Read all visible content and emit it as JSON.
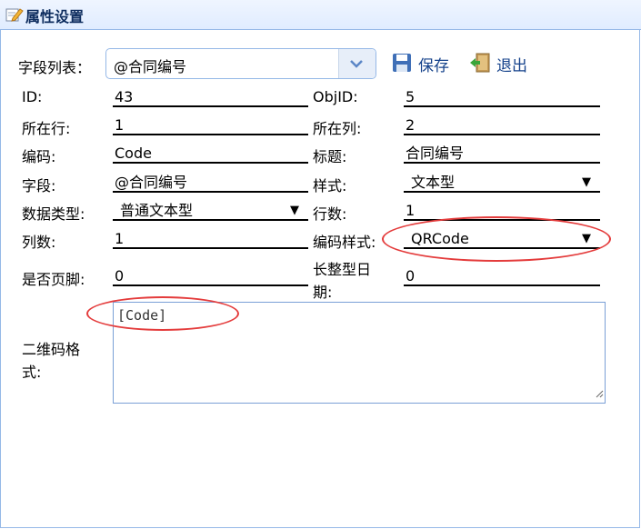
{
  "header": {
    "title": "属性设置",
    "icon": "edit-icon"
  },
  "toolbar": {
    "field_list_label": "字段列表：",
    "field_list_value": "@合同编号",
    "save_label": "保存",
    "exit_label": "退出"
  },
  "fields": {
    "id_label": "ID:",
    "id_value": "43",
    "objid_label": "ObjID:",
    "objid_value": "5",
    "row_label": "所在行:",
    "row_value": "1",
    "col_label": "所在列:",
    "col_value": "2",
    "code_label": "编码:",
    "code_value": "Code",
    "title_label": "标题:",
    "title_value": "合同编号",
    "field_label": "字段:",
    "field_value": "@合同编号",
    "style_label": "样式:",
    "style_value": "文本型",
    "datatype_label": "数据类型:",
    "datatype_value": "普通文本型",
    "rows_label": "行数:",
    "rows_value": "1",
    "cols_label": "列数:",
    "cols_value": "1",
    "codestyle_label": "编码样式:",
    "codestyle_value": "QRCode",
    "footer_label": "是否页脚:",
    "footer_value": "0",
    "longdate_label_1": "长整型日",
    "longdate_label_2": "期:",
    "longdate_value": "0",
    "qrformat_label_1": "二维码格",
    "qrformat_label_2": "式:",
    "qrformat_value": "[Code]"
  },
  "colors": {
    "accent": "#15428b",
    "border": "#95b8e7",
    "highlight": "#e43c3c"
  }
}
